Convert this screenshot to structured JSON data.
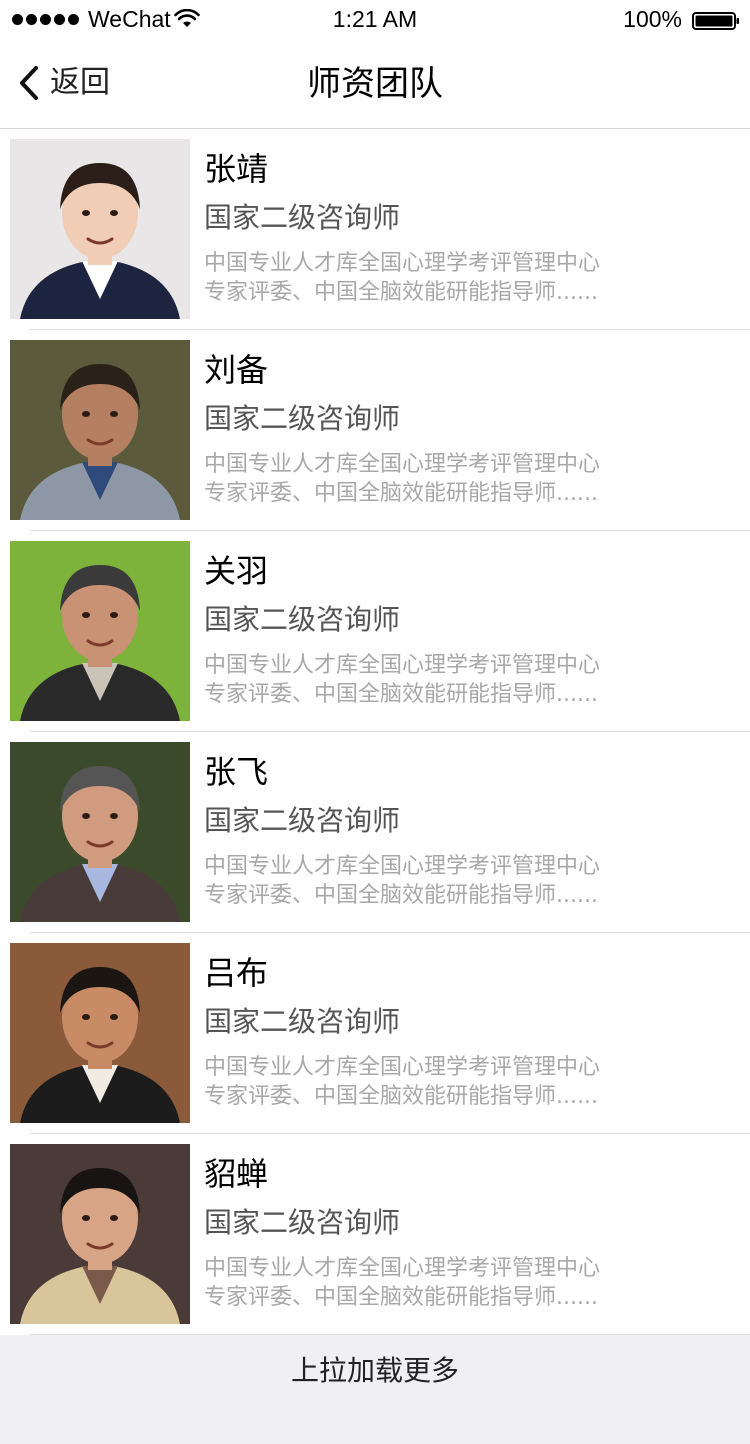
{
  "status_bar": {
    "carrier": "WeChat",
    "time": "1:21 AM",
    "battery_percent": "100%",
    "icons": [
      "signal-dots-icon",
      "wifi-icon",
      "battery-icon"
    ]
  },
  "nav": {
    "back_label": "返回",
    "back_icon": "chevron-left-icon",
    "title": "师资团队"
  },
  "teachers": [
    {
      "name": "张靖",
      "title": "国家二级咨询师",
      "desc_line1": "中国专业人才库全国心理学考评管理中心",
      "desc_line2": "专家评委、中国全脑效能研能指导师......",
      "avatar": {
        "bg": "#e8e6e6",
        "skin": "#f1cdb6",
        "hair": "#2b1d17",
        "clothes": "#1d2440",
        "shirt": "#ffffff"
      }
    },
    {
      "name": "刘备",
      "title": "国家二级咨询师",
      "desc_line1": "中国专业人才库全国心理学考评管理中心",
      "desc_line2": "专家评委、中国全脑效能研能指导师......",
      "avatar": {
        "bg": "#5c5a3c",
        "skin": "#b58062",
        "hair": "#2a2218",
        "clothes": "#8e97a6",
        "shirt": "#2e4b7c"
      }
    },
    {
      "name": "关羽",
      "title": "国家二级咨询师",
      "desc_line1": "中国专业人才库全国心理学考评管理中心",
      "desc_line2": "专家评委、中国全脑效能研能指导师......",
      "avatar": {
        "bg": "#7db33b",
        "skin": "#c99274",
        "hair": "#3a3a3a",
        "clothes": "#2a2a2a",
        "shirt": "#c9c3b8"
      }
    },
    {
      "name": "张飞",
      "title": "国家二级咨询师",
      "desc_line1": "中国专业人才库全国心理学考评管理中心",
      "desc_line2": "专家评委、中国全脑效能研能指导师......",
      "avatar": {
        "bg": "#3a4a2a",
        "skin": "#d19b80",
        "hair": "#555555",
        "clothes": "#4a3b3b",
        "shirt": "#a8b8e0"
      }
    },
    {
      "name": "吕布",
      "title": "国家二级咨询师",
      "desc_line1": "中国专业人才库全国心理学考评管理中心",
      "desc_line2": "专家评委、中国全脑效能研能指导师......",
      "avatar": {
        "bg": "#8a5a3a",
        "skin": "#c98b66",
        "hair": "#1c1612",
        "clothes": "#1c1c1c",
        "shirt": "#f0ece4"
      }
    },
    {
      "name": "貂蝉",
      "title": "国家二级咨询师",
      "desc_line1": "中国专业人才库全国心理学考评管理中心",
      "desc_line2": "专家评委、中国全脑效能研能指导师......",
      "avatar": {
        "bg": "#4a3a38",
        "skin": "#d7a586",
        "hair": "#181414",
        "clothes": "#d8c69a",
        "shirt": "#7a5a4a"
      }
    }
  ],
  "footer": {
    "load_more_label": "上拉加载更多"
  },
  "colors": {
    "nav_border": "#d6d6d8",
    "desc_text": "#a8a8a8",
    "title_text": "#555555",
    "footer_bg": "#efeff4"
  }
}
